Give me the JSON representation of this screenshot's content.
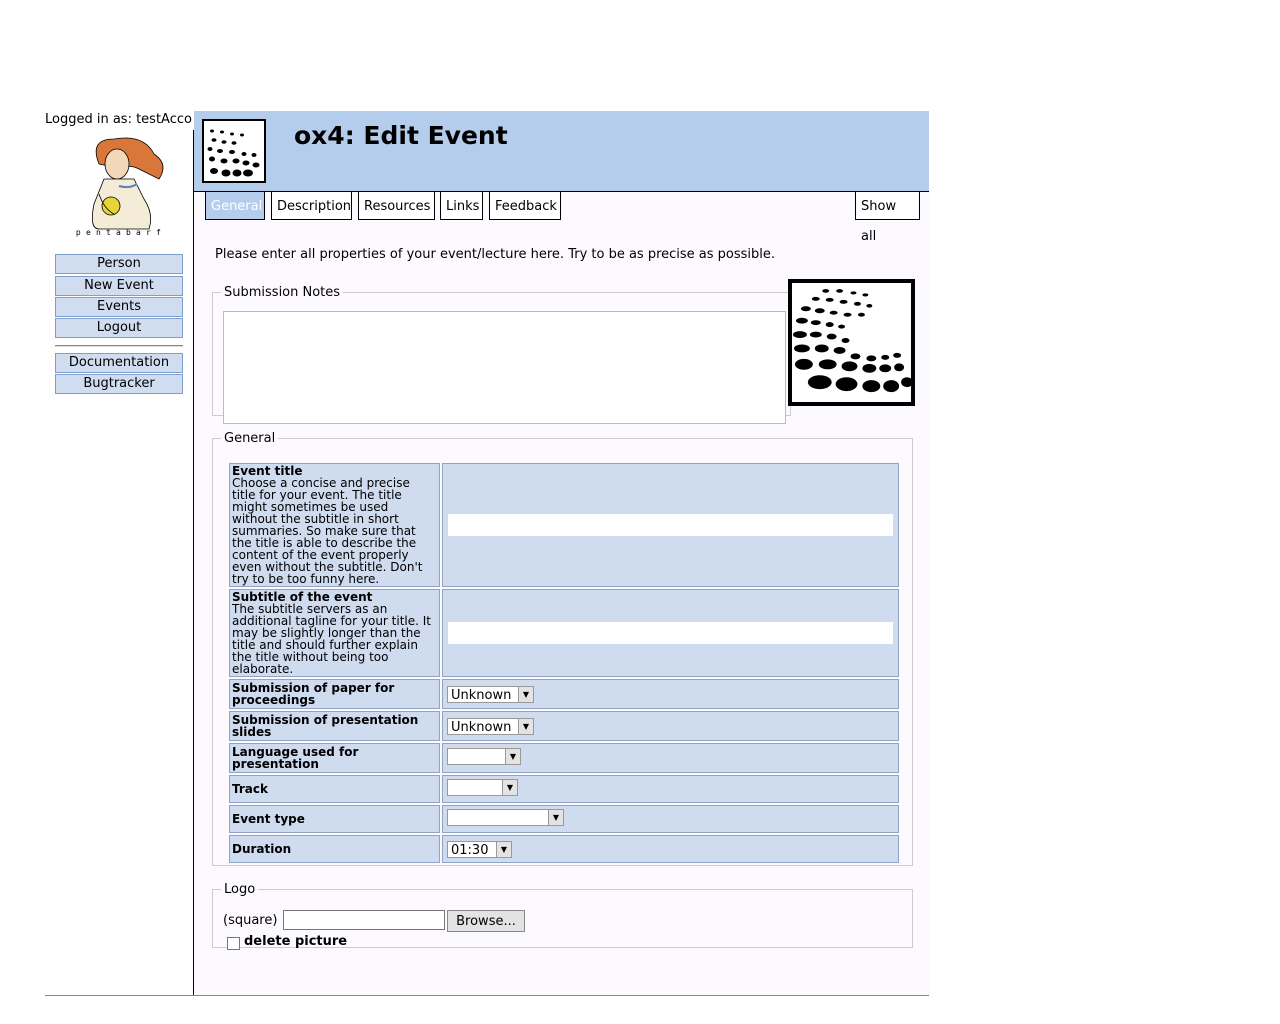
{
  "login": {
    "text": "Logged in as: testAccount"
  },
  "brand": "pentabarf",
  "nav": {
    "main": [
      "Person",
      "New Event",
      "Events",
      "Logout"
    ],
    "extra": [
      "Documentation",
      "Bugtracker"
    ]
  },
  "header": {
    "title": "ox4: Edit Event"
  },
  "tabs": [
    "General",
    "Description",
    "Resources",
    "Links",
    "Feedback"
  ],
  "show_all": "Show all",
  "intro": "Please enter all properties of your event/lecture here. Try to be as precise as possible.",
  "notes": {
    "legend": "Submission Notes",
    "value": ""
  },
  "general": {
    "legend": "General",
    "event_title": {
      "label": "Event title",
      "help": "Choose a concise and precise title for your event. The title might sometimes be used without the subtitle in short summaries. So make sure that the title is able to describe the content of the event properly even without the subtitle. Don't try to be too funny here.",
      "value": ""
    },
    "subtitle": {
      "label": "Subtitle of the event",
      "help": "The subtitle servers as an additional tagline for your title. It may be slightly longer than the title and should further explain the title without being too elaborate.",
      "value": ""
    },
    "paper": {
      "label": "Submission of paper for proceedings",
      "value": "Unknown"
    },
    "slides": {
      "label": "Submission of presentation slides",
      "value": "Unknown"
    },
    "language": {
      "label": "Language used for presentation",
      "value": ""
    },
    "track": {
      "label": "Track",
      "value": ""
    },
    "event_type": {
      "label": "Event type",
      "value": ""
    },
    "duration": {
      "label": "Duration",
      "value": "01:30"
    }
  },
  "logo": {
    "legend": "Logo",
    "square_label": "(square)",
    "browse_label": "Browse...",
    "delete_label": "delete picture"
  }
}
